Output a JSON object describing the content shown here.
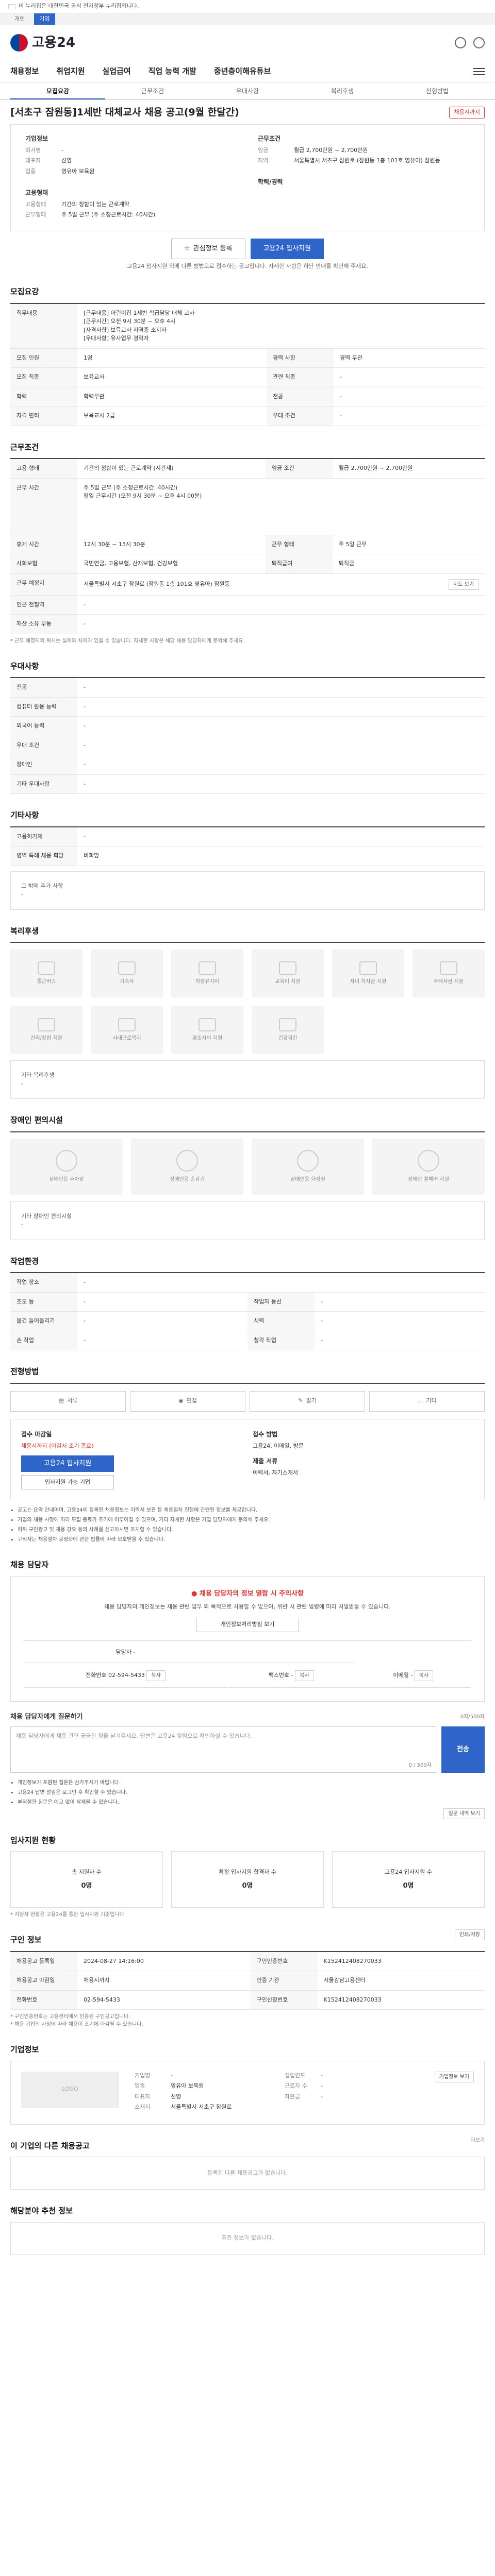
{
  "gov_banner": {
    "text": "이 누리집은 대한민국 공식 전자정부 누리집입니다."
  },
  "subnav": {
    "items": [
      "개인",
      "기업"
    ],
    "active": "기업"
  },
  "header": {
    "logo_text": "고용24"
  },
  "mainnav": {
    "items": [
      "채용정보",
      "취업지원",
      "실업급여",
      "직업 능력 개발",
      "중년층이해유튜브"
    ]
  },
  "tabs": [
    "모집요강",
    "근무조건",
    "우대사항",
    "복리후생",
    "전형방법"
  ],
  "job": {
    "title": "[서초구 잠원동]1세반 대체교사 채용 공고(9월 한달간)",
    "badge": "채용시까지",
    "company_title": "기업정보",
    "company_rows": [
      {
        "k": "회사명",
        "v": "-"
      },
      {
        "k": "대표자",
        "v": "선영"
      },
      {
        "k": "업종",
        "v": "영유아 보육원"
      }
    ],
    "condition_title": "근무조건",
    "condition_rows": [
      {
        "k": "임금",
        "v": "월급 2,700만원 ~ 2,700만원"
      },
      {
        "k": "지역",
        "v": "서울특별시 서초구 잠원로 (잠원동 1층 101호 영유아) 잠원동"
      }
    ],
    "type_title": "고용형태",
    "type_rows": [
      {
        "k": "고용형태",
        "v": "기간의 정함이 있는 근로계약"
      },
      {
        "k": "근무형태",
        "v": "주 5일 근무 (주 소정근로시간: 40시간)"
      }
    ],
    "career_title": "학력/경력",
    "btn_scrap": "관심정보 등록",
    "btn_apply": "고용24 입사지원",
    "note": "고용24 입사지원 외에 다른 방법으로 접수하는 공고입니다. 자세한 사항은 하단 안내를 확인해 주세요."
  },
  "recruit": {
    "title": "모집요강",
    "duty_label": "직무내용",
    "duty_text": "[근무내용] 어린이집 1세반 학급담당 대체 교사\n[근무시간] 오전 9시 30분 ~ 오후 4시\n[자격사항] 보육교사 자격증 소지자\n[우대사항] 유사업무 경력자",
    "rows": [
      {
        "k": "모집 인원",
        "v": "1명",
        "k2": "경력 사항",
        "v2": "경력 무관"
      },
      {
        "k": "모집 직종",
        "v": "보육교사",
        "k2": "관련 직종",
        "v2": "-"
      },
      {
        "k": "학력",
        "v": "학력무관",
        "k2": "전공",
        "v2": "-"
      },
      {
        "k": "자격 면허",
        "v": "보육교사 2급",
        "k2": "우대 조건",
        "v2": "-"
      }
    ]
  },
  "work": {
    "title": "근무조건",
    "rows": [
      {
        "k": "고용 형태",
        "v": "기간의 정함이 있는 근로계약 (시간제)",
        "k2": "임금 조건",
        "v2": "월급 2,700만원 ~ 2,700만원"
      },
      {
        "k": "근무 시간",
        "v": "주 5일 근무 (주 소정근로시간: 40시간)\n평일 근무시간 (오전 9시 30분 ~ 오후 4시 00분)",
        "k2": "",
        "v2": ""
      },
      {
        "k": "휴게 시간",
        "v": "12시 30분 ~ 13시 30분",
        "k2": "근무 형태",
        "v2": "주 5일 근무"
      },
      {
        "k": "사회보험",
        "v": "국민연금, 고용보험, 산재보험, 건강보험",
        "k2": "퇴직급여",
        "v2": "퇴직금"
      },
      {
        "k": "근무 예정지",
        "v": "서울특별시 서초구 잠원로 (잠원동 1층 101호 영유아) 잠원동",
        "k2": "",
        "v2": ""
      },
      {
        "k": "인근 전철역",
        "v": "-",
        "k2": "",
        "v2": ""
      },
      {
        "k": "재산 소유 부동",
        "v": "-",
        "k2": "",
        "v2": ""
      }
    ],
    "map_button": "지도 보기",
    "footnote": "* 근무 예정지의 위치는 실제와 차이가 있을 수 있습니다. 자세한 사항은 해당 채용 담당자에게 문의해 주세요."
  },
  "prefer": {
    "title": "우대사항",
    "rows": [
      {
        "k": "전공",
        "v": "-"
      },
      {
        "k": "컴퓨터 활용 능력",
        "v": "-"
      },
      {
        "k": "외국어 능력",
        "v": "-"
      },
      {
        "k": "우대 조건",
        "v": "-"
      },
      {
        "k": "장애인",
        "v": "-"
      },
      {
        "k": "기타 우대사항",
        "v": "-"
      }
    ]
  },
  "etc": {
    "title": "기타사항",
    "rows": [
      {
        "k": "고용허가제",
        "v": "-"
      },
      {
        "k": "병역 특례 채용 희망",
        "v": "비희망"
      }
    ],
    "extra_label": "그 밖에 추가 사항",
    "extra_value": "-"
  },
  "welfare": {
    "title": "복리후생",
    "items": [
      "통근버스",
      "기숙사",
      "차량유지비",
      "교육비 지원",
      "자녀 학자금 지원",
      "주택자금 지원",
      "전직/창업 지원",
      "사내근로복지",
      "경조사비 지원",
      "건강검진"
    ],
    "other_label": "기타 복리후생",
    "other_value": "-"
  },
  "disability": {
    "title": "장애인 편의시설",
    "items": [
      "장애인용 주차장",
      "장애인용 승강기",
      "장애인용 화장실",
      "장애인 휠체어 지원"
    ],
    "other_label": "기타 장애인 편의시설",
    "other_value": "-"
  },
  "environment": {
    "title": "작업환경",
    "rows": [
      {
        "k": "작업 장소",
        "v": "-",
        "k2": "",
        "v2": ""
      },
      {
        "k": "조도 등",
        "v": "-",
        "k2": "작업자 동선",
        "v2": "-"
      },
      {
        "k": "물건 들어올리기",
        "v": "-",
        "k2": "시력",
        "v2": "-"
      },
      {
        "k": "손 작업",
        "v": "-",
        "k2": "청각 작업",
        "v2": "-"
      }
    ]
  },
  "process": {
    "title": "전형방법",
    "steps": [
      "서류",
      "면접",
      "필기",
      "기타"
    ],
    "apply_title": "접수 마감일",
    "apply_deadline": "채용시까지 (마감시 조기 종료)",
    "apply_button": "고용24 입사지원",
    "apply_button2": "입사지원 가능 기업",
    "method_title": "접수 방법",
    "method_value": "고용24, 이메일, 방문",
    "doc_title": "제출 서류",
    "doc_value": "이력서, 자기소개서",
    "notices": [
      "공고는 요약 안내이며, 고용24에 등록된 채용정보는 이력서 보관 등 채용절차 진행에 관련된 정보를 제공합니다.",
      "기업의 채용 사정에 따라 모집 종료가 조기에 이루어질 수 있으며, 기타 자세한 사항은 기업 담당자에게 문의해 주세요.",
      "허위 구인광고 및 채용 강요 등의 사례를 신고하시면 조치할 수 있습니다.",
      "구직자는 채용절차 공정화에 관한 법률에 따라 보호받을 수 있습니다."
    ]
  },
  "manager": {
    "title": "채용 담당자",
    "alert_title": "채용 담당자의 정보 열람 시 주의사항",
    "alert_desc": "채용 담당자의 개인정보는 채용 관련 업무 외 목적으로 사용할 수 없으며, 위반 시 관련 법령에 따라 처벌받을 수 있습니다.",
    "alert_btn": "개인정보처리방침 보기",
    "name_label": "담당자",
    "name_value": "-",
    "phone_label": "전화번호",
    "phone_value": "02-594-5433",
    "fax_label": "팩스번호",
    "fax_value": "-",
    "email_label": "이메일",
    "email_value": "-",
    "btn_copy": "복사",
    "question_title": "채용 담당자에게 질문하기",
    "question_hint": "0자/500자",
    "question_placeholder": "채용 담당자에게 채용 관련 궁금한 점을 남겨주세요. 답변은 고용24 알림으로 확인하실 수 있습니다.",
    "question_counter": "0 / 500자",
    "send": "전송",
    "question_notes": [
      "개인정보가 포함된 질문은 삼가주시기 바랍니다.",
      "고용24 답변 알림은 로그인 후 확인할 수 있습니다.",
      "부적절한 질문은 예고 없이 삭제될 수 있습니다."
    ],
    "question_button": "질문 내역 보기"
  },
  "applicants": {
    "title": "입사지원 현황",
    "items": [
      {
        "label": "총 지원자 수",
        "value": "0명"
      },
      {
        "label": "확정 입사지원 합격자 수",
        "value": "0명"
      },
      {
        "label": "고용24 입사지원 수",
        "value": "0명"
      }
    ],
    "note": "* 지원자 현황은 고용24를 통한 입사지원 기준입니다."
  },
  "job_info": {
    "title": "구인 정보",
    "print": "인쇄/저장",
    "rows": [
      {
        "k": "채용공고 등록일",
        "v": "2024-08-27 14:16:00",
        "k2": "구인인증번호",
        "v2": "K152412408270033"
      },
      {
        "k": "채용공고 마감일",
        "v": "채용시까지",
        "k2": "인증 기관",
        "v2": "서울강남고용센터"
      },
      {
        "k": "전화번호",
        "v": "02-594-5433",
        "k2": "구인신청번호",
        "v2": "K152412408270033"
      }
    ],
    "notes": [
      "* 구인인증번호는 고용센터에서 인증된 구인공고입니다.",
      "* 채용 기업의 사정에 따라 채용이 조기에 마감될 수 있습니다."
    ]
  },
  "company": {
    "title": "기업정보",
    "logo_placeholder": "LOGO",
    "rows": [
      {
        "k": "기업명",
        "v": "-"
      },
      {
        "k": "업종",
        "v": "영유아 보육원"
      },
      {
        "k": "대표자",
        "v": "선영"
      },
      {
        "k": "소재지",
        "v": "서울특별시 서초구 잠원로"
      }
    ],
    "rows2": [
      {
        "k": "설립연도",
        "v": "-"
      },
      {
        "k": "근로자 수",
        "v": "-"
      },
      {
        "k": "자본금",
        "v": "-"
      }
    ],
    "btn": "기업정보 보기"
  },
  "others": {
    "title": "이 기업의 다른 채용공고",
    "more": "더보기",
    "empty": "등록된 다른 채용공고가 없습니다."
  },
  "recommend": {
    "title": "해당분야 추천 정보",
    "empty": "추천 정보가 없습니다."
  }
}
